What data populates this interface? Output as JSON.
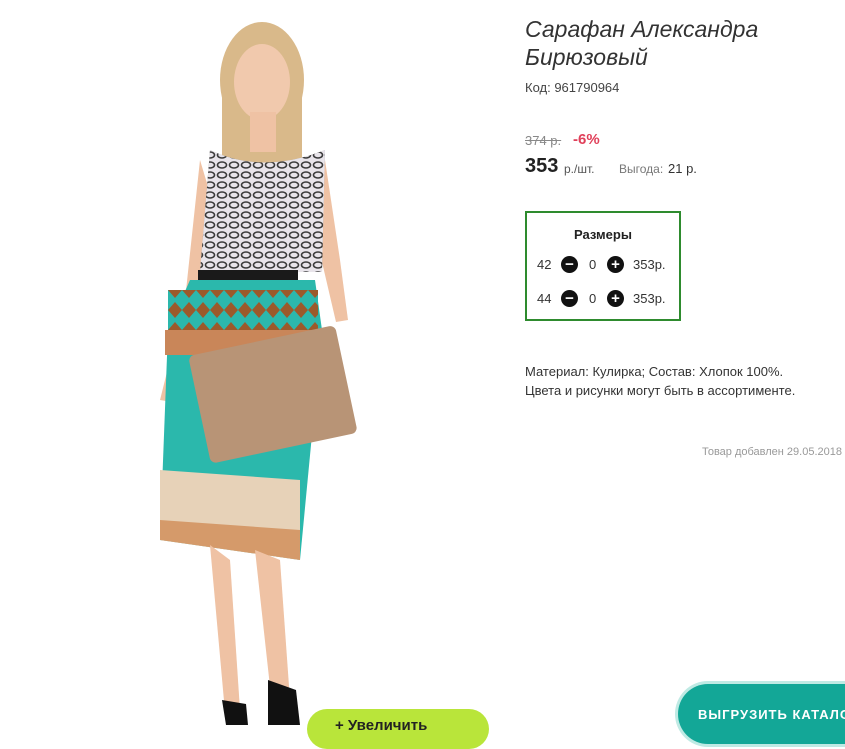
{
  "product": {
    "title": "Сарафан Александра Бирюзовый",
    "code": "Код: 961790964",
    "old_price": "374 р.",
    "discount": "-6%",
    "price": "353",
    "price_unit": "р./шт.",
    "savings_label": "Выгода:",
    "savings_value": "21 р.",
    "description_line1": "Материал: Кулирка; Состав: Хлопок 100%.",
    "description_line2": "Цвета и рисунки могут быть в ассортименте.",
    "added": "Товар добавлен 29.05.2018"
  },
  "sizes": {
    "title": "Размеры",
    "rows": [
      {
        "size": "42",
        "qty": "0",
        "price": "353р."
      },
      {
        "size": "44",
        "qty": "0",
        "price": "353р."
      }
    ]
  },
  "buttons": {
    "zoom": "+  Увеличить",
    "export": "ВЫГРУЗИТЬ КАТАЛОГ"
  },
  "colors": {
    "accent_green": "#2e8b2e",
    "discount_red": "#e0405a",
    "zoom_lime": "#b9e53a",
    "export_teal": "#13a797"
  }
}
